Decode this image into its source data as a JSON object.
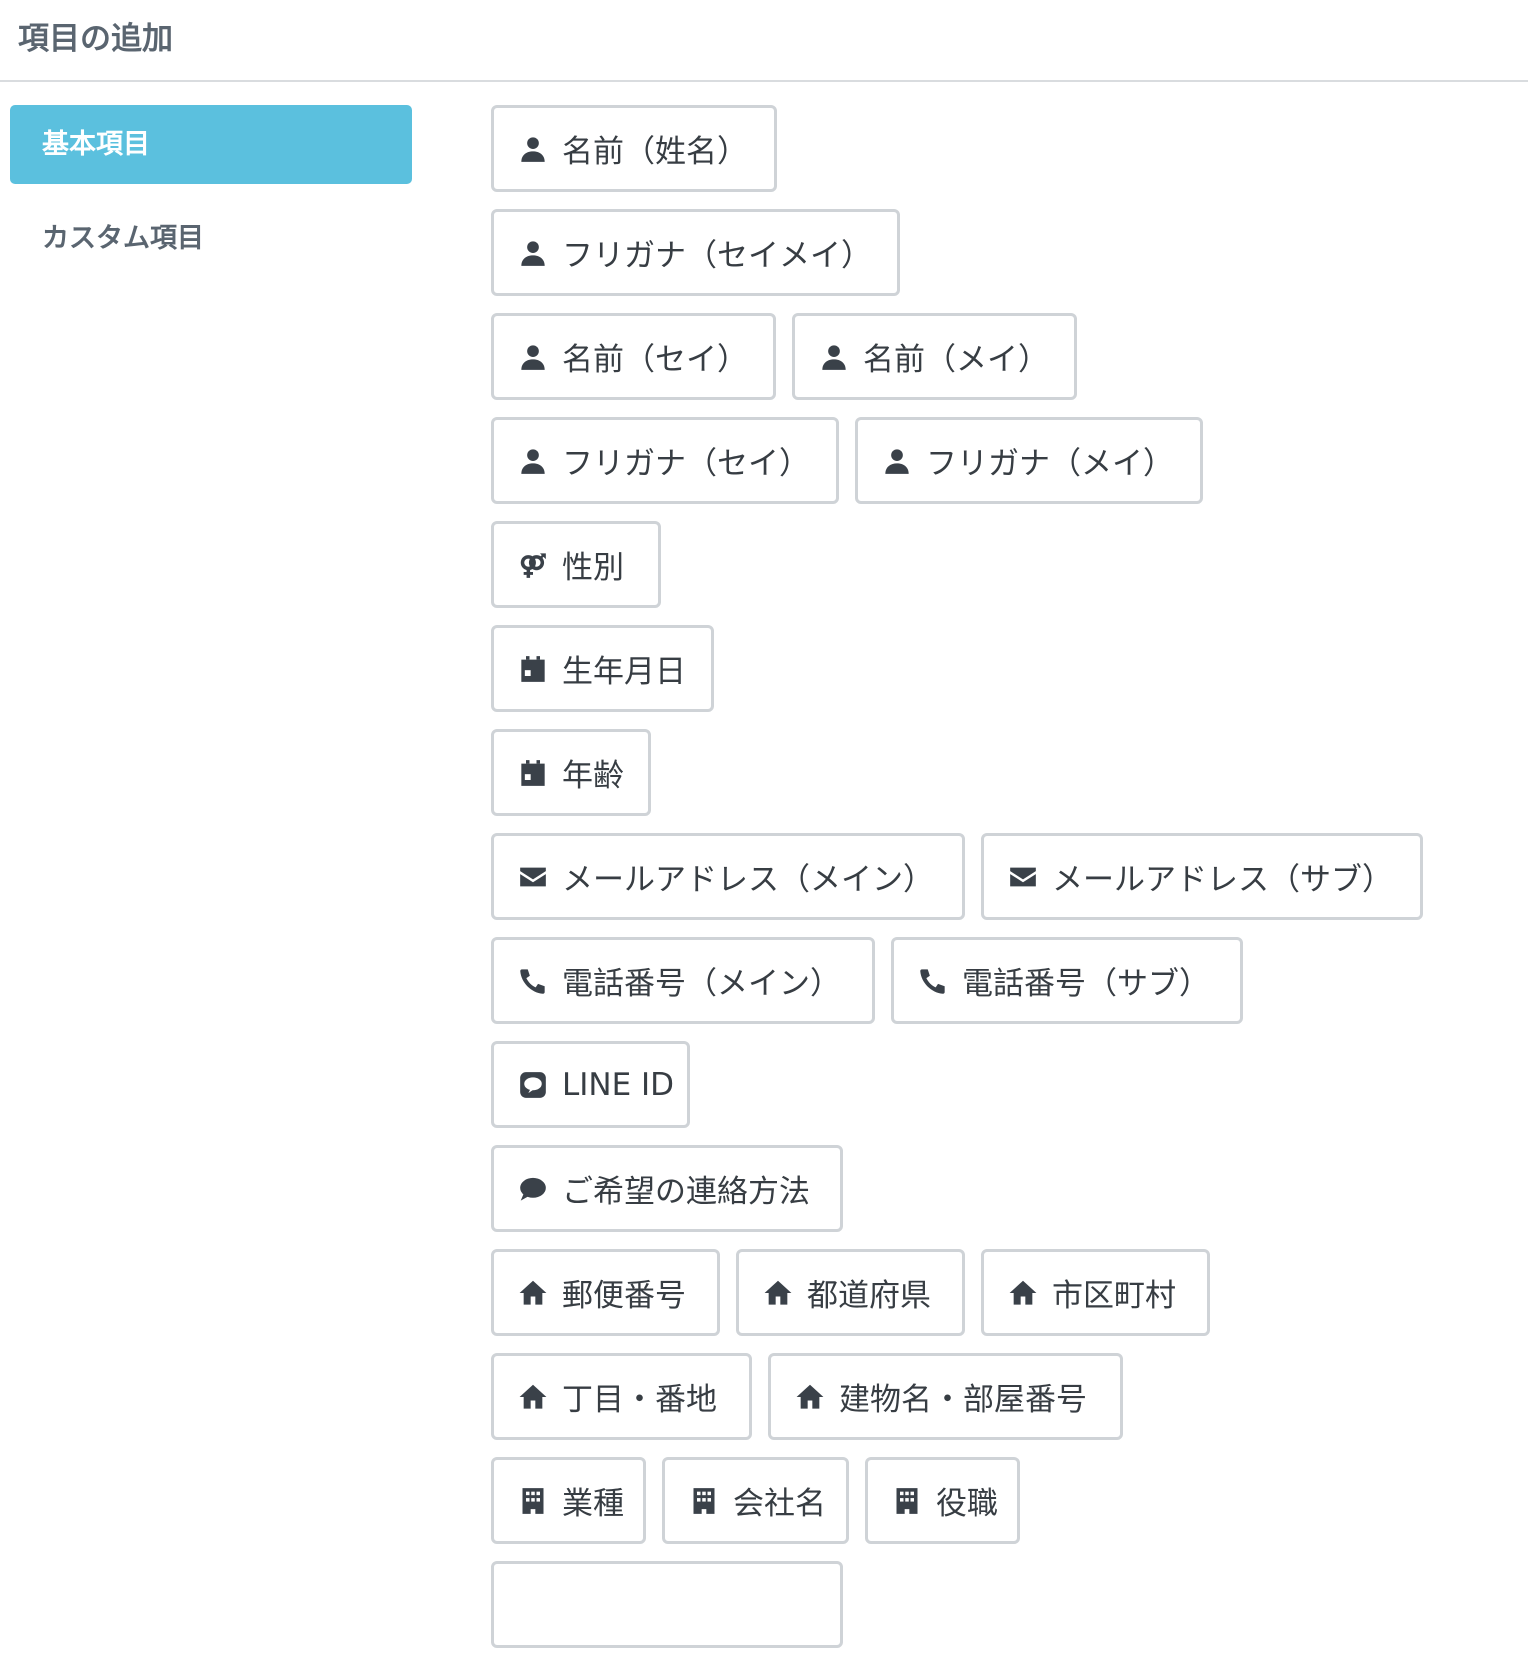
{
  "header": {
    "title": "項目の追加"
  },
  "sidebar": {
    "items": [
      {
        "label": "基本項目",
        "active": true
      },
      {
        "label": "カスタム項目",
        "active": false
      }
    ]
  },
  "fields": {
    "name_full": "名前（姓名）",
    "kana_full": "フリガナ（セイメイ）",
    "name_sei": "名前（セイ）",
    "name_mei": "名前（メイ）",
    "kana_sei": "フリガナ（セイ）",
    "kana_mei": "フリガナ（メイ）",
    "gender": "性別",
    "birthday": "生年月日",
    "age": "年齢",
    "email_main": "メールアドレス（メイン）",
    "email_sub": "メールアドレス（サブ）",
    "phone_main": "電話番号（メイン）",
    "phone_sub": "電話番号（サブ）",
    "line_id": "LINE ID",
    "contact_method": "ご希望の連絡方法",
    "postal_code": "郵便番号",
    "prefecture": "都道府県",
    "city": "市区町村",
    "street": "丁目・番地",
    "building": "建物名・部屋番号",
    "industry": "業種",
    "company": "会社名",
    "position": "役職"
  },
  "icons": {
    "person": "user-icon",
    "gender": "venus-mars-icon",
    "calendar": "calendar-icon",
    "mail": "envelope-icon",
    "phone": "phone-icon",
    "line": "line-icon",
    "chat": "comment-icon",
    "home": "home-icon",
    "building": "building-icon"
  },
  "colors": {
    "accent": "#5bc0de",
    "border": "#cfd3d7",
    "text": "#373d43",
    "muted": "#5a6570"
  }
}
